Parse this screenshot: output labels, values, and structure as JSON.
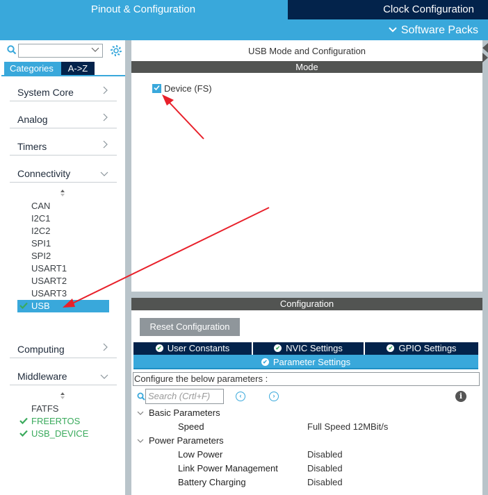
{
  "topbar": {
    "tab_pinout": "Pinout & Configuration",
    "tab_clock": "Clock Configuration",
    "software_packs": "Software Packs"
  },
  "sidebar": {
    "search_value": "",
    "tabs": [
      "Categories",
      "A->Z"
    ],
    "categories": [
      {
        "label": "System Core",
        "expanded": false
      },
      {
        "label": "Analog",
        "expanded": false
      },
      {
        "label": "Timers",
        "expanded": false
      },
      {
        "label": "Connectivity",
        "expanded": true
      },
      {
        "label": "Computing",
        "expanded": false
      },
      {
        "label": "Middleware",
        "expanded": true
      }
    ],
    "connectivity_items": [
      {
        "label": "CAN",
        "enabled": false
      },
      {
        "label": "I2C1",
        "enabled": false
      },
      {
        "label": "I2C2",
        "enabled": false
      },
      {
        "label": "SPI1",
        "enabled": false
      },
      {
        "label": "SPI2",
        "enabled": false
      },
      {
        "label": "USART1",
        "enabled": false
      },
      {
        "label": "USART2",
        "enabled": false
      },
      {
        "label": "USART3",
        "enabled": false
      },
      {
        "label": "USB",
        "enabled": true,
        "selected": true
      }
    ],
    "middleware_items": [
      {
        "label": "FATFS",
        "enabled": false
      },
      {
        "label": "FREERTOS",
        "enabled": true
      },
      {
        "label": "USB_DEVICE",
        "enabled": true
      }
    ]
  },
  "main": {
    "title": "USB Mode and Configuration",
    "mode_header": "Mode",
    "device_label": "Device (FS)",
    "device_checked": true
  },
  "config": {
    "header": "Configuration",
    "reset_button": "Reset Configuration",
    "tabs": [
      "User Constants",
      "NVIC Settings",
      "GPIO Settings"
    ],
    "active_tab": "Parameter Settings",
    "configure_text": "Configure the below parameters :",
    "search_placeholder": "Search (Crtl+F)",
    "groups": [
      {
        "name": "Basic Parameters",
        "params": [
          {
            "name": "Speed",
            "value": "Full Speed 12MBit/s"
          }
        ]
      },
      {
        "name": "Power Parameters",
        "params": [
          {
            "name": "Low Power",
            "value": "Disabled"
          },
          {
            "name": "Link Power Management",
            "value": "Disabled"
          },
          {
            "name": "Battery Charging",
            "value": "Disabled"
          }
        ]
      }
    ]
  },
  "colors": {
    "accent": "#39a8db",
    "dark_navy": "#03234b",
    "header_gray": "#525452",
    "ok_green": "#3aaa5c",
    "annotation_red": "#e8202a"
  }
}
